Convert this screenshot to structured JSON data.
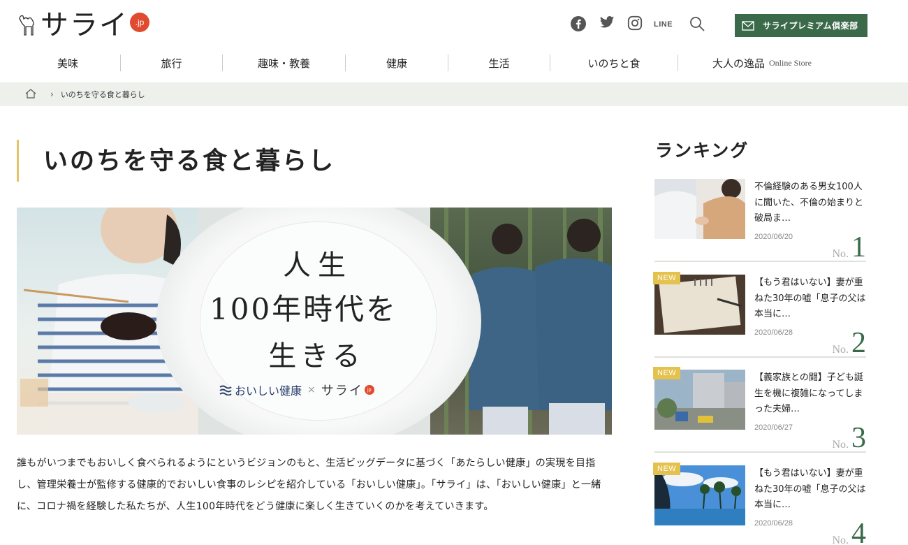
{
  "header": {
    "logo_text": "サライ",
    "logo_badge": ".jp",
    "social": [
      "facebook-icon",
      "twitter-icon",
      "instagram-icon",
      "LINE",
      "search-icon"
    ],
    "line_label": "LINE",
    "premium_label": "サライプレミアム倶楽部"
  },
  "nav": {
    "items": [
      {
        "label": "美味"
      },
      {
        "label": "旅行"
      },
      {
        "label": "趣味・教養"
      },
      {
        "label": "健康"
      },
      {
        "label": "生活"
      },
      {
        "label": "いのちと食"
      },
      {
        "label": "大人の逸品",
        "sub": "Online Store"
      }
    ]
  },
  "breadcrumb": {
    "current": "いのちを守る食と暮らし"
  },
  "page": {
    "title": "いのちを守る食と暮らし"
  },
  "hero": {
    "line1": "人生",
    "line2_a": "100年時代",
    "line2_b": "を",
    "line3": "生きる",
    "partner": "おいしい健康",
    "cross": "×",
    "sarai": "サライ",
    "jp": "jp"
  },
  "description": "誰もがいつまでもおいしく食べられるようにというビジョンのもと、生活ビッグデータに基づく「あたらしい健康」の実現を目指し、管理栄養士が監修する健康的でおいしい食事のレシピを紹介している「おいしい健康」。「サライ」は、「おいしい健康」と一緒に、コロナ禍を経験した私たちが、人生100年時代をどう健康に楽しく生きていくのかを考えていきます。",
  "ranking": {
    "heading": "ランキング",
    "no_label": "No.",
    "new_label": "NEW",
    "items": [
      {
        "title": "不倫経験のある男女100人に聞いた、不倫の始まりと破局ま…",
        "date": "2020/06/20",
        "rank": "1",
        "is_new": false
      },
      {
        "title": "【もう君はいない】妻が重ねた30年の嘘「息子の父は本当に…",
        "date": "2020/06/28",
        "rank": "2",
        "is_new": true
      },
      {
        "title": "【義家族との闘】子ども誕生を機に複雑になってしまった夫婦…",
        "date": "2020/06/27",
        "rank": "3",
        "is_new": true
      },
      {
        "title": "【もう君はいない】妻が重ねた30年の嘘「息子の父は本当に…",
        "date": "2020/06/28",
        "rank": "4",
        "is_new": true
      }
    ]
  },
  "colors": {
    "accent_green": "#3a6a4a",
    "accent_gold": "#e5c14e",
    "logo_red": "#e04a2f"
  }
}
